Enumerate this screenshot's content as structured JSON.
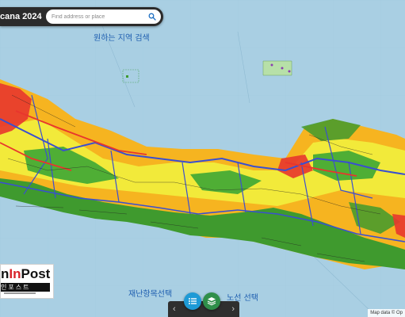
{
  "header": {
    "app_title": "cana 2024",
    "search_placeholder": "Find address or place",
    "search_icon": "search-icon"
  },
  "map_labels": {
    "search_hint": "원하는 지역 검색",
    "disaster_hint": "재난항목선택",
    "route_hint": "노선 선택"
  },
  "controls": {
    "list_icon": "list-icon",
    "layers_icon": "layers-icon",
    "prev_arrow": "‹",
    "next_arrow": "›"
  },
  "attribution": "Map data © Op",
  "logo": {
    "main_prefix": "n",
    "main_highlight": "In",
    "main_suffix": "Post",
    "sub": "인포스트"
  },
  "colors": {
    "sea": "#a9cfe3",
    "hazard_high": "#e8362d",
    "hazard_medium": "#f6b420",
    "hazard_low": "#f2ea3a",
    "vegetation": "#3f9a2e",
    "roads": "#3a4fd0",
    "app_accent": "#1e9ad6"
  }
}
